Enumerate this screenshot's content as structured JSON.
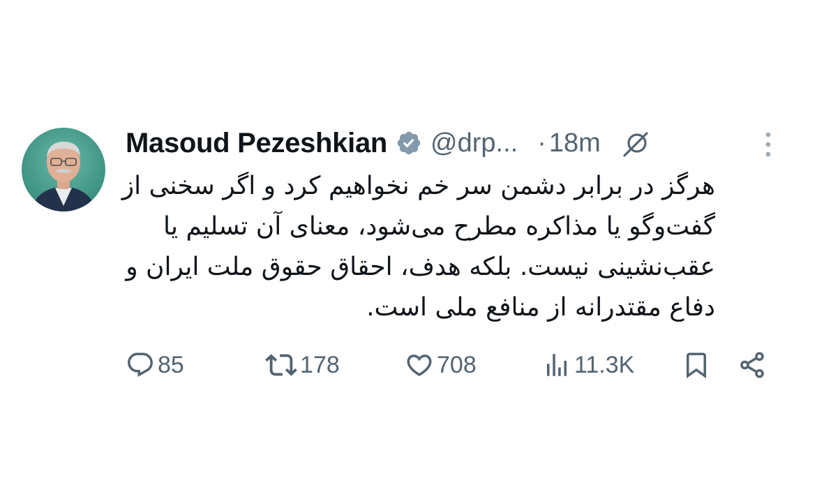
{
  "tweet": {
    "display_name": "Masoud Pezeshkian",
    "handle": "@drp...",
    "separator": "·",
    "time": "18m",
    "text_lines": [
      "هرگز در برابر دشمن سر خم نخواهیم کرد و اگر سخنی از",
      "گفت‌وگو یا مذاکره مطرح می‌شود، معنای آن تسلیم یا",
      "عقب‌نشینی نیست. بلکه هدف، احقاق حقوق ملت ایران و",
      "دفاع مقتدرانه از منافع ملی است."
    ],
    "verified_badge_color": "#829aab",
    "icons": {
      "verified": "verified-badge-icon",
      "grok": "grok-icon",
      "more": "more-vertical-icon"
    }
  },
  "actions": {
    "reply": {
      "icon": "reply-icon",
      "count": "85"
    },
    "retweet": {
      "icon": "retweet-icon",
      "count": "178"
    },
    "like": {
      "icon": "heart-icon",
      "count": "708"
    },
    "views": {
      "icon": "views-icon",
      "count": "11.3K"
    },
    "bookmark": {
      "icon": "bookmark-icon"
    },
    "share": {
      "icon": "share-icon"
    }
  },
  "colors": {
    "text_primary": "#0f1419",
    "text_secondary": "#536471",
    "background": "#ffffff"
  }
}
